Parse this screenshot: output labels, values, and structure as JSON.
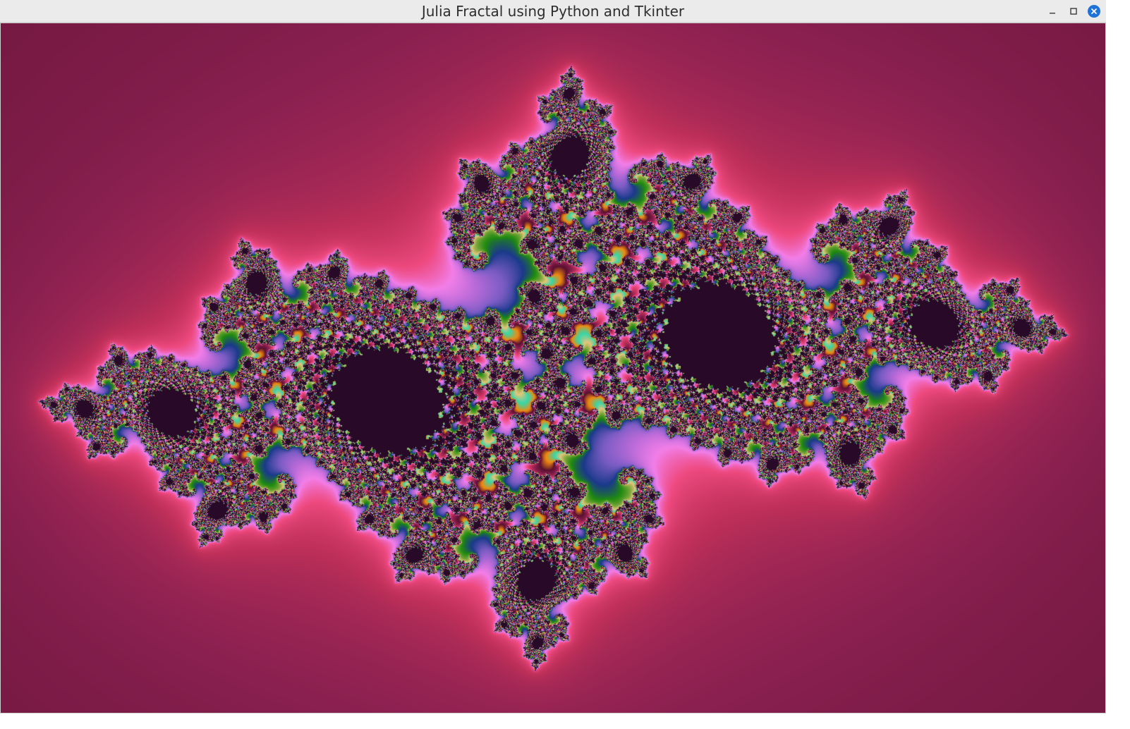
{
  "window": {
    "title": "Julia Fractal using Python and Tkinter",
    "controls": {
      "minimize_icon": "minimize-icon",
      "maximize_icon": "maximize-icon",
      "close_icon": "close-icon",
      "close_color": "#1e73d8"
    }
  },
  "fractal": {
    "palette": [
      "#5a1030",
      "#8a2050",
      "#c0305a",
      "#ee4a80",
      "#f27ee8",
      "#b86ad8",
      "#7b5cc4",
      "#1a3a8a",
      "#1f8a10",
      "#7aa63a",
      "#e6c47a",
      "#39d6a8",
      "#f08a10"
    ]
  }
}
